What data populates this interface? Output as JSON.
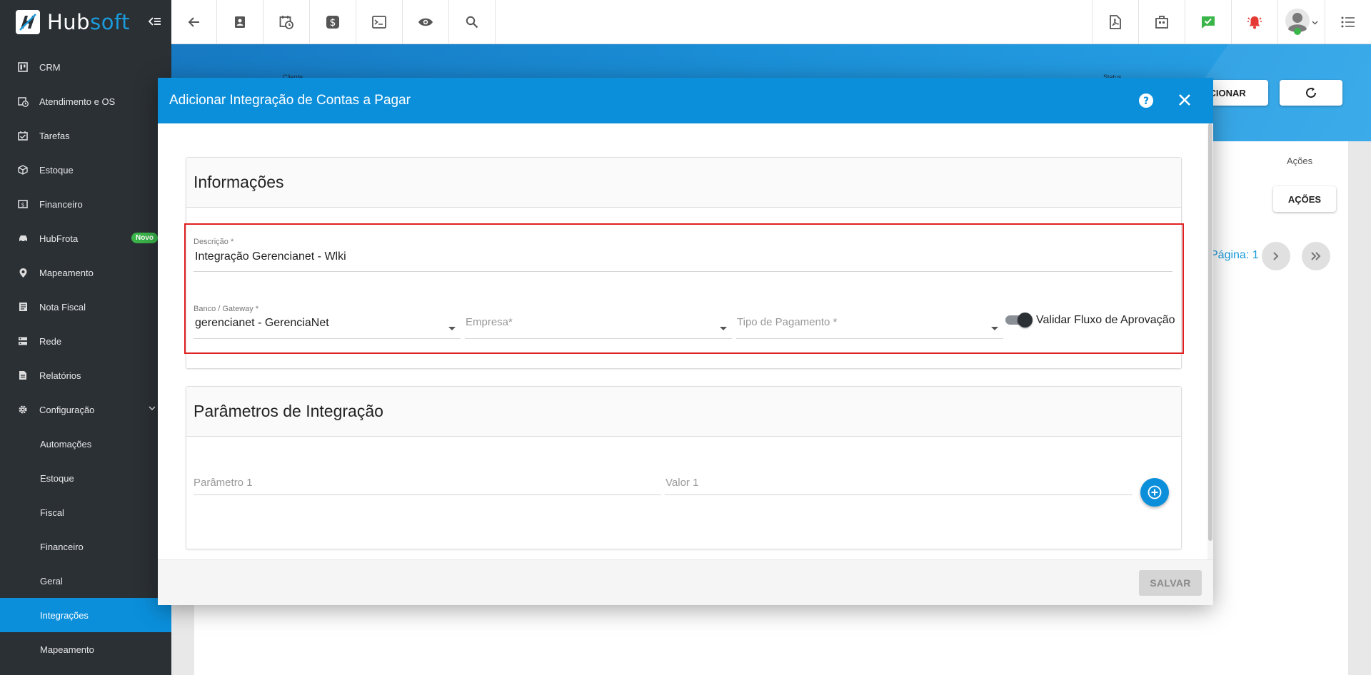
{
  "brand": {
    "name_part1": "Hub",
    "name_part2": "soft"
  },
  "sidebar": {
    "items": [
      {
        "label": "CRM",
        "icon": "kanban-icon"
      },
      {
        "label": "Atendimento e OS",
        "icon": "clock-calendar-icon"
      },
      {
        "label": "Tarefas",
        "icon": "tasks-icon"
      },
      {
        "label": "Estoque",
        "icon": "box-icon"
      },
      {
        "label": "Financeiro",
        "icon": "money-icon"
      },
      {
        "label": "HubFrota",
        "icon": "car-icon",
        "badge": "Novo"
      },
      {
        "label": "Mapeamento",
        "icon": "map-pin-icon"
      },
      {
        "label": "Nota Fiscal",
        "icon": "invoice-icon"
      },
      {
        "label": "Rede",
        "icon": "server-icon"
      },
      {
        "label": "Relatórios",
        "icon": "report-icon"
      },
      {
        "label": "Configuração",
        "icon": "gear-icon"
      }
    ],
    "subitems": [
      {
        "label": "Automações"
      },
      {
        "label": "Estoque"
      },
      {
        "label": "Fiscal"
      },
      {
        "label": "Financeiro"
      },
      {
        "label": "Geral"
      },
      {
        "label": "Integrações",
        "active": true
      },
      {
        "label": "Mapeamento"
      }
    ]
  },
  "background": {
    "tiny_left": "Cliente",
    "tiny_right": "Status",
    "add_button": "ADICIONAR",
    "actions_header": "Ações",
    "actions_button": "AÇÕES",
    "page_label": "Página: 1"
  },
  "modal": {
    "title": "Adicionar Integração de Contas a Pagar",
    "section_info": {
      "title": "Informações",
      "descricao_label": "Descrição *",
      "descricao_value": "Integração Gerencianet - Wlki",
      "banco_label": "Banco / Gateway *",
      "banco_value": "gerencianet - GerenciaNet",
      "empresa_placeholder": "Empresa*",
      "tipo_placeholder": "Tipo de Pagamento *",
      "toggle_label": "Validar Fluxo de Aprovação",
      "toggle_on": true
    },
    "section_params": {
      "title": "Parâmetros de Integração",
      "param_placeholder": "Parâmetro 1",
      "value_placeholder": "Valor 1"
    },
    "save_label": "SALVAR"
  },
  "colors": {
    "sidebar_bg": "#2b3035",
    "accent": "#0b8fdb",
    "highlight": "#e02020",
    "success": "#3ab54a",
    "danger": "#e53935"
  }
}
